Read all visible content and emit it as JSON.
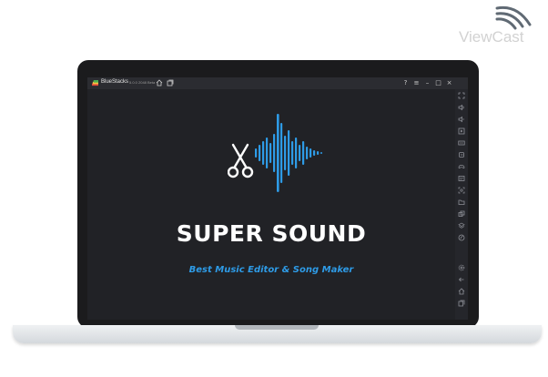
{
  "watermark": {
    "text": "ViewCast"
  },
  "window": {
    "app_name": "BlueStacks",
    "app_version": "5.0.0 2048 Beta",
    "controls": {
      "help": "?",
      "menu": "≡",
      "minimize": "–",
      "maximize": "□",
      "close": "×"
    }
  },
  "app_screen": {
    "title": "SUPER SOUND",
    "subtitle": "Best Music Editor & Song Maker"
  },
  "sidebar": {
    "icons": [
      "fullscreen-icon",
      "volume-up-icon",
      "volume-down-icon",
      "play-icon",
      "keyboard-icon",
      "rotate-icon",
      "gamepad-icon",
      "apk-icon",
      "screenshot-icon",
      "folder-icon",
      "multi-instance-icon",
      "layers-icon",
      "eco-icon",
      "settings-icon",
      "back-icon",
      "home-icon",
      "recent-apps-icon"
    ]
  },
  "colors": {
    "accent_blue": "#2e9be6",
    "screen_bg": "#212226",
    "titlebar_bg": "#2b2c31"
  }
}
